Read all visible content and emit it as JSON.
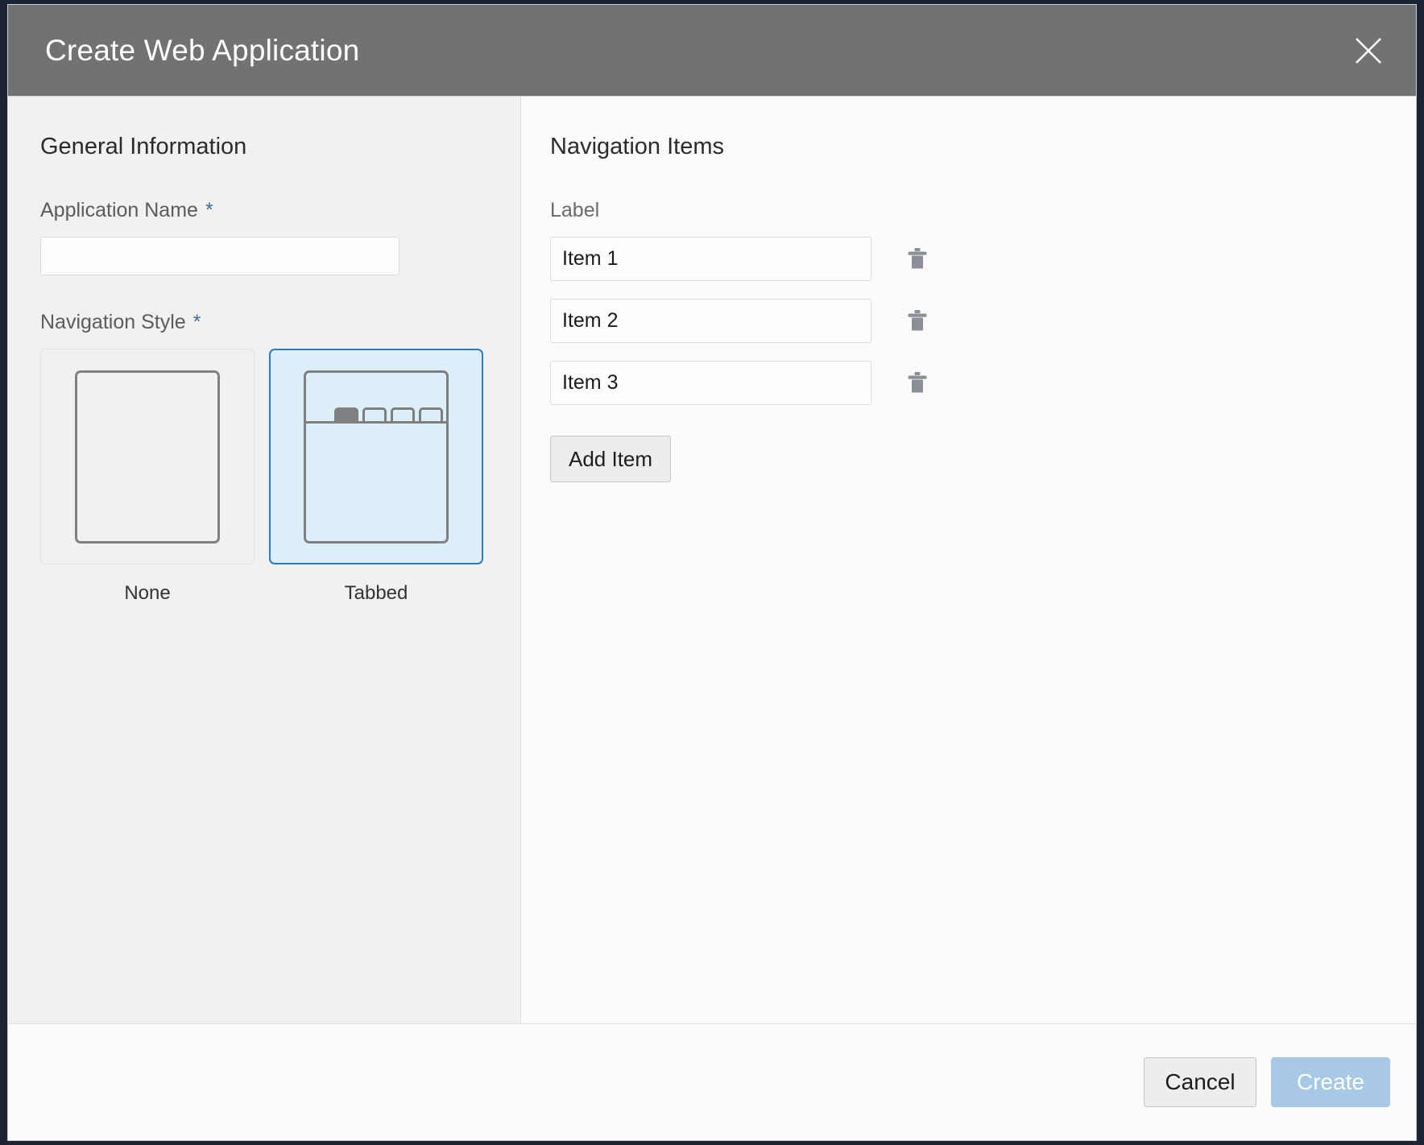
{
  "dialog": {
    "title": "Create Web Application",
    "close_icon": "close-icon"
  },
  "general": {
    "heading": "General Information",
    "app_name": {
      "label": "Application Name",
      "required_marker": "*",
      "value": "",
      "placeholder": ""
    },
    "nav_style": {
      "label": "Navigation Style",
      "required_marker": "*",
      "options": [
        {
          "caption": "None",
          "selected": false,
          "icon": "plain-page-icon"
        },
        {
          "caption": "Tabbed",
          "selected": true,
          "icon": "tabbed-page-icon"
        }
      ],
      "selected_value": "Tabbed"
    }
  },
  "navigation_items": {
    "heading": "Navigation Items",
    "column_header": "Label",
    "items": [
      {
        "value": "Item 1",
        "delete_icon": "trash-icon"
      },
      {
        "value": "Item 2",
        "delete_icon": "trash-icon"
      },
      {
        "value": "Item 3",
        "delete_icon": "trash-icon"
      }
    ],
    "add_label": "Add Item"
  },
  "footer": {
    "cancel_label": "Cancel",
    "create_label": "Create"
  },
  "colors": {
    "header_bg": "#707274",
    "accent_blue": "#2b7bbd",
    "selected_card_bg": "#ddeff9",
    "required_star": "#3c6e9f",
    "create_button_bg": "#a7c9e6",
    "panel_left_bg": "#f1f1f1",
    "panel_right_bg": "#fbfbfb"
  }
}
